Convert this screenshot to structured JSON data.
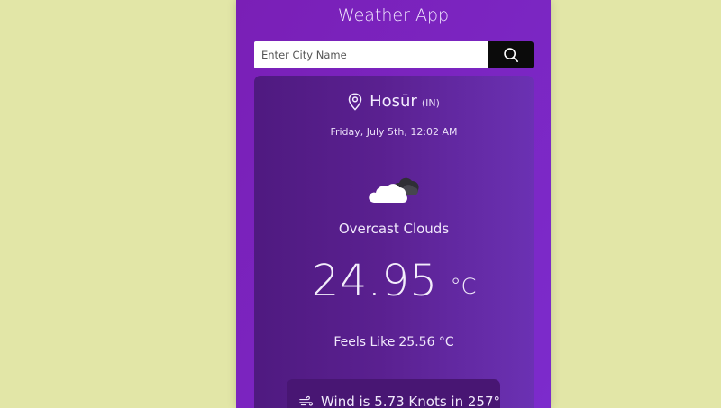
{
  "app": {
    "title": "Weather App"
  },
  "search": {
    "placeholder": "Enter City Name",
    "button_icon": "search-icon"
  },
  "weather": {
    "location_icon": "map-pin-icon",
    "city": "Hosūr",
    "country": "(IN)",
    "date": "Friday, July 5th, 12:02 AM",
    "condition_icon": "overcast-clouds-icon",
    "description": "Overcast Clouds",
    "temperature": "24.95",
    "unit": "°C",
    "feels_like_label": "Feels Like",
    "feels_like_value": "25.56 °C",
    "wind_icon": "wind-icon",
    "wind": "Wind is 5.73 Knots in 257°"
  },
  "colors": {
    "page_bg": "#e2e6a7",
    "app_bg": "#7a1fb6",
    "card_bg": "#5a2090",
    "search_button": "#0b0b0b"
  }
}
